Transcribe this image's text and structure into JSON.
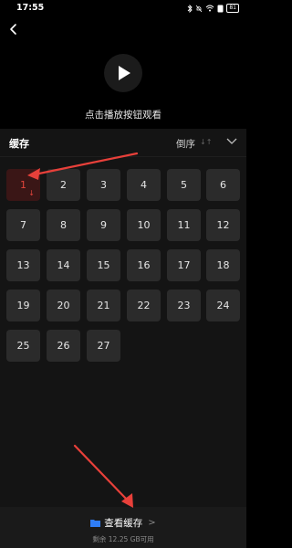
{
  "status_bar": {
    "time": "17:55",
    "battery": "81"
  },
  "player": {
    "hint": "点击播放按钮观看"
  },
  "cache": {
    "title": "缓存",
    "sort_label": "倒序",
    "sort_icon": "↓↑",
    "episodes": [
      "1",
      "2",
      "3",
      "4",
      "5",
      "6",
      "7",
      "8",
      "9",
      "10",
      "11",
      "12",
      "13",
      "14",
      "15",
      "16",
      "17",
      "18",
      "19",
      "20",
      "21",
      "22",
      "23",
      "24",
      "25",
      "26",
      "27"
    ],
    "active_episode": "1",
    "download_mark": "↓"
  },
  "bottom": {
    "view_label": "查看缓存",
    "arrow": ">",
    "storage": "剩余 12.25 GB可用"
  },
  "colors": {
    "accent": "#e2443b",
    "annotation": "#e8403a",
    "folder": "#2f7df6"
  }
}
